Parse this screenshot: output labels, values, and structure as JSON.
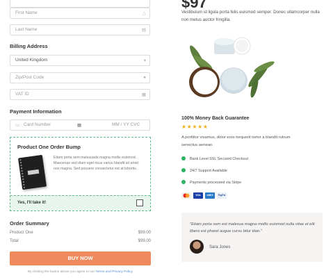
{
  "price": "$97",
  "product_description": "Vestibulum id ligula porta felis euismod semper. Donec ullamcorper nulla non metus auctor fringilla.",
  "form": {
    "first_name_placeholder": "First Name",
    "last_name_placeholder": "Last Name",
    "billing_title": "Billing Address",
    "country_value": "United Kingdom",
    "zip_placeholder": "Zip/Post Code",
    "vat_placeholder": "VAT ID",
    "payment_title": "Payment Information",
    "card_placeholder": "Card Number",
    "expiry_placeholder": "MM / YY  CVC"
  },
  "order_bump": {
    "title": "Product One Order Bump",
    "description": "Etiam porta sem malesuada magna mollis euismod. Maecenas sed diam eget risus varius blandit sit amet non magna. Sed posuere consectetur est at lobortis.",
    "accept_label": "Yes, I'll take it!"
  },
  "summary": {
    "title": "Order Summary",
    "rows": [
      {
        "label": "Product One",
        "value": "$99.00"
      },
      {
        "label": "Total",
        "value": "$99.00"
      }
    ]
  },
  "cta": {
    "buy_label": "BUY NOW",
    "terms_prefix": "By clicking the button above you agree to our ",
    "terms_link": "Terms and Privacy Policy"
  },
  "guarantee": {
    "title": "100% Money Back Guarantee",
    "stars": "★★★★★",
    "text": "A porttitor vivamus, dolor eros torquent tortor a blandit rutrum senectus aenean."
  },
  "features": [
    "Bank Level SSL Secured Checkout",
    "24/7 Support Available",
    "Payments processed via Stripe"
  ],
  "payment_cards": [
    {
      "name": "mastercard-icon",
      "color": "#f4f0ec"
    },
    {
      "name": "visa-icon",
      "color": "#1a3fa8"
    },
    {
      "name": "amex-icon",
      "color": "#2a79c8"
    },
    {
      "name": "paypal-icon",
      "color": "#eaeff6"
    }
  ],
  "testimonial": {
    "quote": "\"Etiam porta sem est malesua magna mollis euismod nulla vitae et elit libero est pharet augue cursu bitur tiian.\"",
    "author": "Sara Jones"
  },
  "colors": {
    "accent": "#ef8a5c",
    "bump_border": "#5fbf8a",
    "check_green": "#2fb168",
    "star": "#f2b01e"
  }
}
